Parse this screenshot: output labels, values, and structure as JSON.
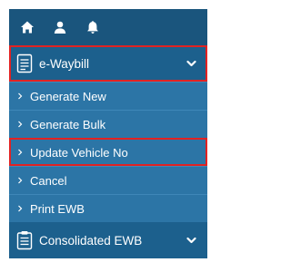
{
  "topbar": {
    "icons": [
      "home-icon",
      "user-icon",
      "bell-icon"
    ]
  },
  "menu": {
    "ewaybill": {
      "label": "e-Waybill",
      "icon": "document-list-icon",
      "expanded": true
    },
    "items": [
      {
        "label": "Generate New"
      },
      {
        "label": "Generate Bulk"
      },
      {
        "label": "Update Vehicle No"
      },
      {
        "label": "Cancel"
      },
      {
        "label": "Print EWB"
      }
    ],
    "consolidated": {
      "label": "Consolidated EWB",
      "icon": "clipboard-icon"
    }
  },
  "colors": {
    "topbar": "#1a557d",
    "header": "#1c608d",
    "subitem": "#2c75a6",
    "highlight": "#e22222"
  }
}
